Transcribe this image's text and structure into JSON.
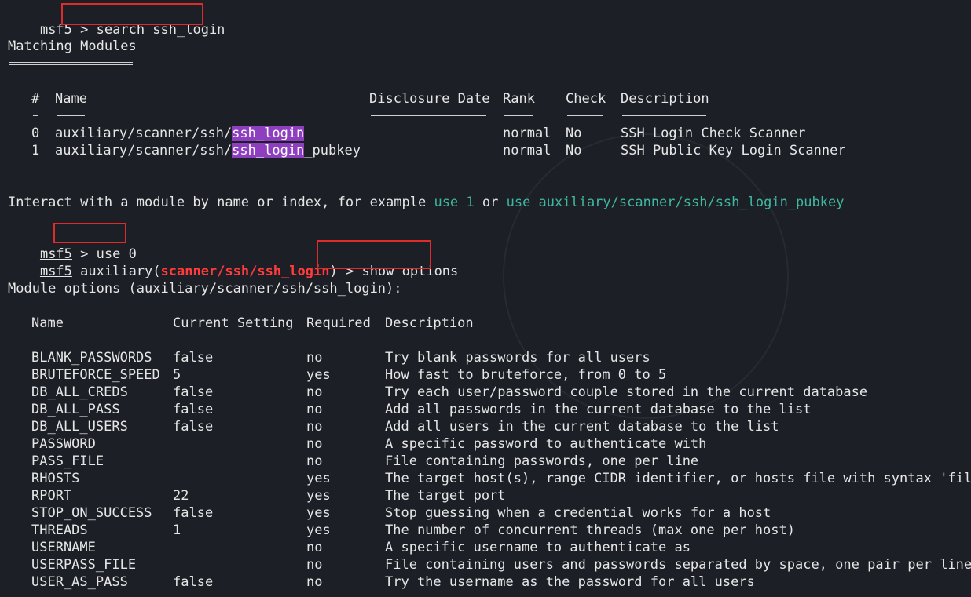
{
  "prompt": "msf5",
  "gt": ">",
  "cmd1": "search ssh_login",
  "matching_title": "Matching Modules",
  "search_table": {
    "headers": [
      "#",
      "Name",
      "Disclosure Date",
      "Rank",
      "Check",
      "Description"
    ],
    "rows": [
      {
        "idx": "0",
        "name_prefix": "auxiliary/scanner/ssh/",
        "name_match": "ssh_login",
        "name_suffix": "",
        "date": "",
        "rank": "normal",
        "check": "No",
        "desc": "SSH Login Check Scanner"
      },
      {
        "idx": "1",
        "name_prefix": "auxiliary/scanner/ssh/",
        "name_match": "ssh_login",
        "name_suffix": "_pubkey",
        "date": "",
        "rank": "normal",
        "check": "No",
        "desc": "SSH Public Key Login Scanner"
      }
    ]
  },
  "interact": {
    "text1": "Interact with a module by name or index, for example ",
    "cmd_a": "use 1",
    "text2": " or ",
    "cmd_b": "use auxiliary/scanner/ssh/ssh_login_pubkey"
  },
  "cmd2": "use 0",
  "module_prompt": {
    "prefix": "auxiliary(",
    "module": "scanner/ssh/ssh_login",
    "suffix": ")"
  },
  "cmd3": "show options",
  "options_title": "Module options (auxiliary/scanner/ssh/ssh_login):",
  "options_table": {
    "headers": [
      "Name",
      "Current Setting",
      "Required",
      "Description"
    ],
    "rows": [
      {
        "name": "BLANK_PASSWORDS",
        "setting": "false",
        "required": "no",
        "desc": "Try blank passwords for all users"
      },
      {
        "name": "BRUTEFORCE_SPEED",
        "setting": "5",
        "required": "yes",
        "desc": "How fast to bruteforce, from 0 to 5"
      },
      {
        "name": "DB_ALL_CREDS",
        "setting": "false",
        "required": "no",
        "desc": "Try each user/password couple stored in the current database"
      },
      {
        "name": "DB_ALL_PASS",
        "setting": "false",
        "required": "no",
        "desc": "Add all passwords in the current database to the list"
      },
      {
        "name": "DB_ALL_USERS",
        "setting": "false",
        "required": "no",
        "desc": "Add all users in the current database to the list"
      },
      {
        "name": "PASSWORD",
        "setting": "",
        "required": "no",
        "desc": "A specific password to authenticate with"
      },
      {
        "name": "PASS_FILE",
        "setting": "",
        "required": "no",
        "desc": "File containing passwords, one per line"
      },
      {
        "name": "RHOSTS",
        "setting": "",
        "required": "yes",
        "desc": "The target host(s), range CIDR identifier, or hosts file with syntax 'file:"
      },
      {
        "name": "RPORT",
        "setting": "22",
        "required": "yes",
        "desc": "The target port"
      },
      {
        "name": "STOP_ON_SUCCESS",
        "setting": "false",
        "required": "yes",
        "desc": "Stop guessing when a credential works for a host"
      },
      {
        "name": "THREADS",
        "setting": "1",
        "required": "yes",
        "desc": "The number of concurrent threads (max one per host)"
      },
      {
        "name": "USERNAME",
        "setting": "",
        "required": "no",
        "desc": "A specific username to authenticate as"
      },
      {
        "name": "USERPASS_FILE",
        "setting": "",
        "required": "no",
        "desc": "File containing users and passwords separated by space, one pair per line"
      },
      {
        "name": "USER_AS_PASS",
        "setting": "false",
        "required": "no",
        "desc": "Try the username as the password for all users"
      }
    ]
  },
  "colors": {
    "background": "#1c1f26",
    "text": "#e6e6e6",
    "highlight": "#8e3fbf",
    "suggestion": "#3fb8a0",
    "module": "#ff3b3b",
    "annotation_box": "#e02b2b"
  }
}
